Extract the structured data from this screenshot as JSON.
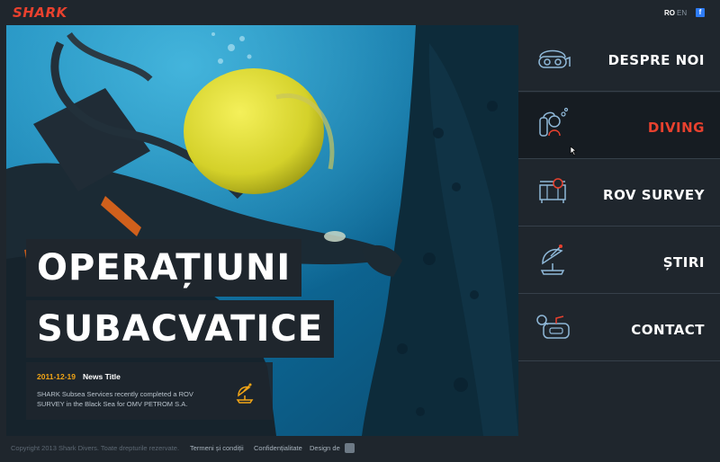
{
  "header": {
    "logo": "SHARK",
    "languages": [
      "RO",
      "EN"
    ],
    "facebook": "f"
  },
  "hero": {
    "headline_line1": "OPERAȚIUNI",
    "headline_line2": "SUBACVATICE",
    "news": {
      "date": "2011-12-19",
      "title": "News Title",
      "text": "SHARK Subsea Services recently completed a ROV SURVEY in the Black Sea for OMV PETROM S.A.",
      "icon": "satellite-dish-icon"
    }
  },
  "menu": {
    "items": [
      {
        "label": "DESPRE NOI",
        "icon": "diving-mask-icon"
      },
      {
        "label": "DIVING",
        "icon": "diver-icon",
        "active": true
      },
      {
        "label": "ROV SURVEY",
        "icon": "rov-icon"
      },
      {
        "label": "ȘTIRI",
        "icon": "satellite-dish-icon"
      },
      {
        "label": "CONTACT",
        "icon": "phone-icon"
      }
    ]
  },
  "footer": {
    "copyright": "Copyright 2013 Shark Divers. Toate drepturile rezervate.",
    "terms": "Termeni și condiții",
    "privacy": "Confidențialitate",
    "design_by": "Design de"
  },
  "colors": {
    "accent_red": "#e8412e",
    "accent_orange": "#f2a516",
    "dark_bg": "#1f262d",
    "icon_blue": "#8fb8d8"
  }
}
